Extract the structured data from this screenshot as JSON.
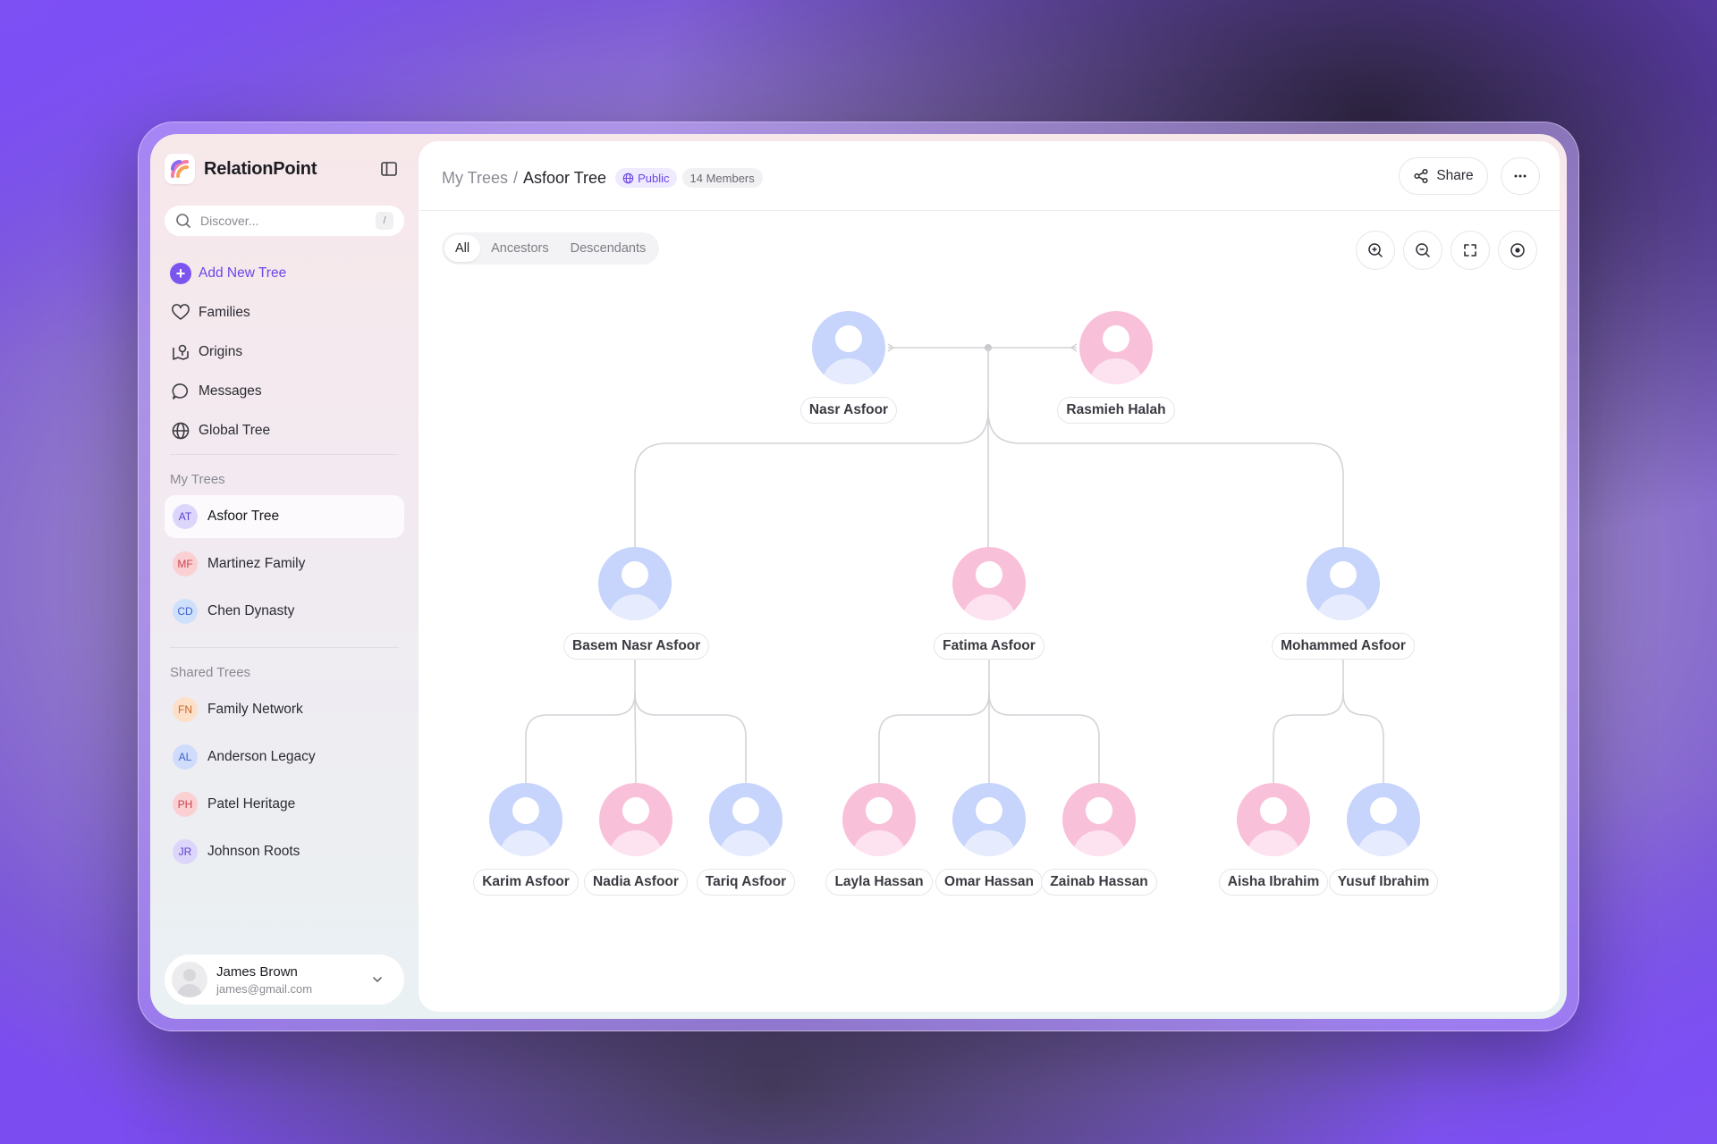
{
  "brand": {
    "name": "RelationPoint"
  },
  "search": {
    "placeholder": "Discover...",
    "shortcut": "/"
  },
  "nav": [
    {
      "label": "Add New Tree",
      "icon": "plus-icon"
    },
    {
      "label": "Families",
      "icon": "heart-icon"
    },
    {
      "label": "Origins",
      "icon": "map-pin-icon"
    },
    {
      "label": "Messages",
      "icon": "chat-icon"
    },
    {
      "label": "Global Tree",
      "icon": "globe-icon"
    }
  ],
  "my_trees": {
    "label": "My Trees",
    "items": [
      {
        "initials": "AT",
        "label": "Asfoor Tree",
        "color": "#ddd6fb",
        "text": "#5a3fd6",
        "active": true
      },
      {
        "initials": "MF",
        "label": "Martinez Family",
        "color": "#fbd0d3",
        "text": "#c8424f"
      },
      {
        "initials": "CD",
        "label": "Chen Dynasty",
        "color": "#cfe0fb",
        "text": "#3d63c9"
      }
    ]
  },
  "shared_trees": {
    "label": "Shared Trees",
    "items": [
      {
        "initials": "FN",
        "label": "Family Network",
        "color": "#fde0c8",
        "text": "#c8692b"
      },
      {
        "initials": "AL",
        "label": "Anderson Legacy",
        "color": "#cfdcfb",
        "text": "#3d63c9"
      },
      {
        "initials": "PH",
        "label": "Patel Heritage",
        "color": "#fbd0d3",
        "text": "#c8424f"
      },
      {
        "initials": "JR",
        "label": "Johnson Roots",
        "color": "#ddd6fb",
        "text": "#5a3fd6"
      }
    ]
  },
  "user": {
    "name": "James Brown",
    "email": "james@gmail.com"
  },
  "header": {
    "crumb_root": "My Trees",
    "crumb_sep": "/",
    "crumb_current": "Asfoor Tree",
    "visibility": "Public",
    "members": "14 Members",
    "share_label": "Share"
  },
  "tabs": [
    {
      "label": "All",
      "active": true
    },
    {
      "label": "Ancestors"
    },
    {
      "label": "Descendants"
    }
  ],
  "tree": {
    "couple": [
      {
        "name": "Nasr Asfoor",
        "gender": "m"
      },
      {
        "name": "Rasmieh Halah",
        "gender": "f"
      }
    ],
    "children": [
      {
        "name": "Basem Nasr Asfoor",
        "gender": "m",
        "children": [
          {
            "name": "Karim Asfoor",
            "gender": "m"
          },
          {
            "name": "Nadia Asfoor",
            "gender": "f"
          },
          {
            "name": "Tariq Asfoor",
            "gender": "m"
          }
        ]
      },
      {
        "name": "Fatima Asfoor",
        "gender": "f",
        "children": [
          {
            "name": "Layla Hassan",
            "gender": "f"
          },
          {
            "name": "Omar Hassan",
            "gender": "m"
          },
          {
            "name": "Zainab Hassan",
            "gender": "f"
          }
        ]
      },
      {
        "name": "Mohammed Asfoor",
        "gender": "m",
        "children": [
          {
            "name": "Aisha Ibrahim",
            "gender": "f"
          },
          {
            "name": "Yusuf Ibrahim",
            "gender": "m"
          }
        ]
      }
    ]
  },
  "colors": {
    "accent": "#7c55ee",
    "male": "#c7d4fb",
    "female": "#f9c0da",
    "line": "#d4d4d8"
  }
}
